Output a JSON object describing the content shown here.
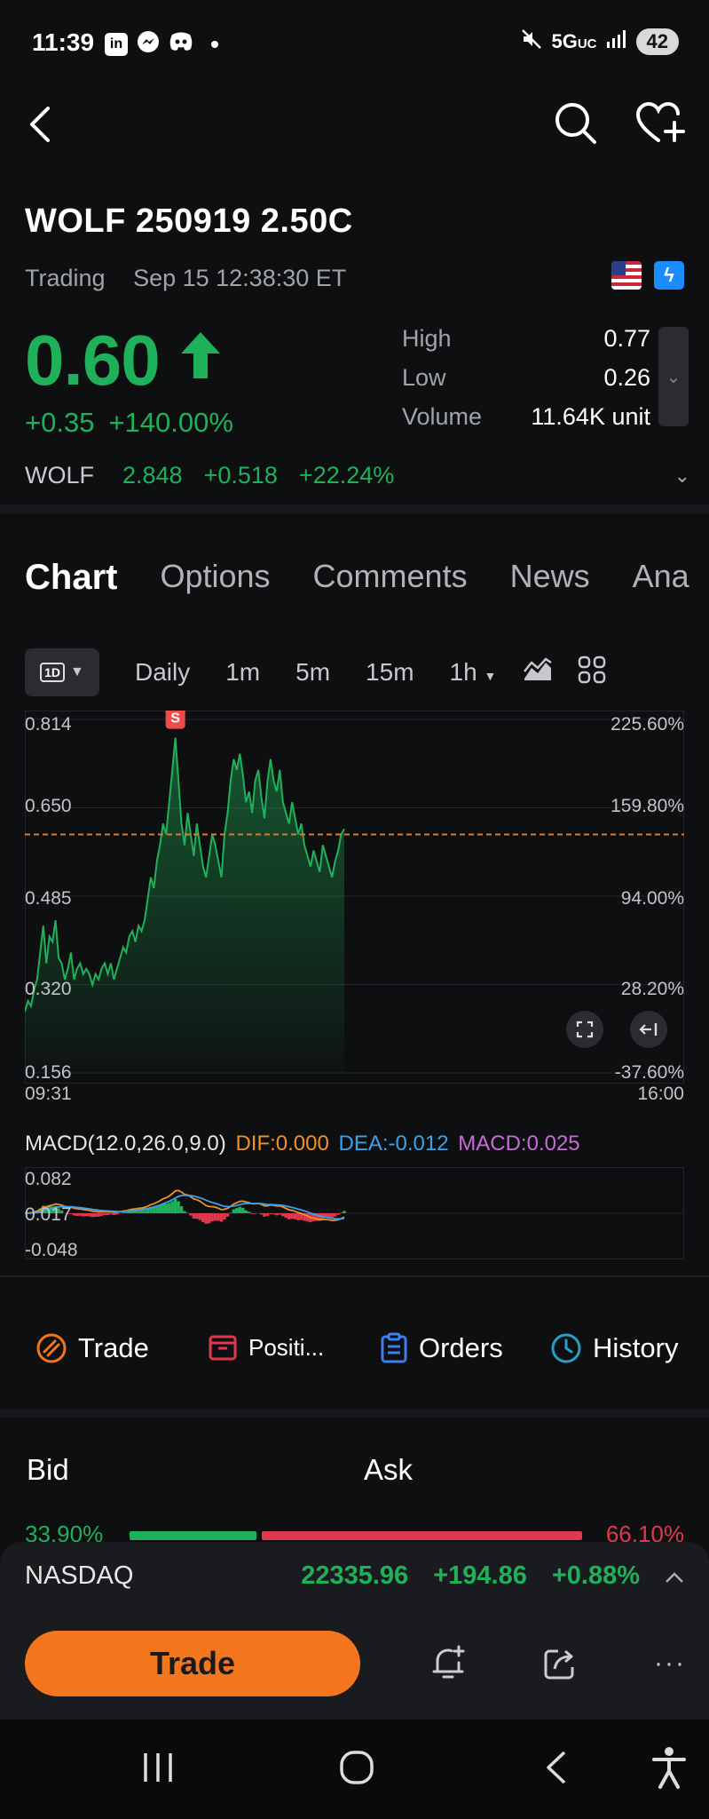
{
  "status_bar": {
    "time": "11:39",
    "app_icons": [
      "linkedin-icon",
      "messenger-icon",
      "discord-icon"
    ],
    "network": "5G",
    "network_suffix": "UC",
    "battery": "42"
  },
  "header": {
    "title": "WOLF 250919 2.50C",
    "state": "Trading",
    "timestamp": "Sep 15 12:38:30 ET",
    "price": "0.60",
    "change": "+0.35",
    "change_pct": "+140.00%",
    "stats": [
      {
        "label": "High",
        "value": "0.77"
      },
      {
        "label": "Low",
        "value": "0.26"
      },
      {
        "label": "Volume",
        "value": "11.64K unit"
      }
    ],
    "underlying": {
      "symbol": "WOLF",
      "price": "2.848",
      "change": "+0.518",
      "change_pct": "+22.24%"
    }
  },
  "tabs": [
    {
      "label": "Chart",
      "active": true,
      "dot": false
    },
    {
      "label": "Options",
      "active": false,
      "dot": false
    },
    {
      "label": "Comments",
      "active": false,
      "dot": true
    },
    {
      "label": "News",
      "active": false,
      "dot": true
    },
    {
      "label": "Ana",
      "active": false,
      "dot": false
    }
  ],
  "chart_toolbar": {
    "period_badge": "1D",
    "periods": [
      "Daily",
      "1m",
      "5m",
      "15m",
      "1h"
    ]
  },
  "chart_data": {
    "type": "area",
    "y_left_ticks": [
      "0.814",
      "0.650",
      "0.485",
      "0.320",
      "0.156"
    ],
    "y_right_ticks": [
      "225.60%",
      "159.80%",
      "94.00%",
      "28.20%",
      "-37.60%"
    ],
    "x_ticks": [
      "09:31",
      "16:00"
    ],
    "ylim": [
      0.156,
      0.814
    ],
    "reference_line": 0.6,
    "marker": "S",
    "values": [
      0.27,
      0.29,
      0.28,
      0.31,
      0.33,
      0.38,
      0.43,
      0.36,
      0.41,
      0.4,
      0.44,
      0.37,
      0.36,
      0.33,
      0.35,
      0.38,
      0.33,
      0.35,
      0.36,
      0.34,
      0.35,
      0.34,
      0.32,
      0.34,
      0.33,
      0.35,
      0.36,
      0.34,
      0.36,
      0.33,
      0.35,
      0.37,
      0.39,
      0.38,
      0.41,
      0.42,
      0.4,
      0.43,
      0.42,
      0.44,
      0.48,
      0.52,
      0.5,
      0.55,
      0.58,
      0.62,
      0.6,
      0.66,
      0.72,
      0.78,
      0.7,
      0.62,
      0.58,
      0.64,
      0.6,
      0.56,
      0.62,
      0.58,
      0.54,
      0.52,
      0.56,
      0.6,
      0.58,
      0.55,
      0.52,
      0.6,
      0.64,
      0.7,
      0.74,
      0.72,
      0.75,
      0.71,
      0.66,
      0.68,
      0.64,
      0.7,
      0.72,
      0.67,
      0.63,
      0.7,
      0.74,
      0.7,
      0.68,
      0.72,
      0.66,
      0.64,
      0.62,
      0.66,
      0.63,
      0.6,
      0.62,
      0.58,
      0.56,
      0.54,
      0.57,
      0.55,
      0.53,
      0.58,
      0.56,
      0.54,
      0.52,
      0.55,
      0.57,
      0.6,
      0.61
    ]
  },
  "macd": {
    "label": "MACD(12.0,26.0,9.0)",
    "dif": "DIF:0.000",
    "dea": "DEA:-0.012",
    "macd": "MACD:0.025",
    "ticks": [
      "0.082",
      "0.017",
      "-0.048"
    ],
    "colors": {
      "dif": "#f0902a",
      "dea": "#3aa0e8",
      "macd": "#c86ad8"
    }
  },
  "actions": [
    {
      "label": "Trade",
      "icon": "trade-icon"
    },
    {
      "label": "Positi...",
      "icon": "positions-icon"
    },
    {
      "label": "Orders",
      "icon": "orders-icon"
    },
    {
      "label": "History",
      "icon": "history-icon"
    }
  ],
  "bid_ask": {
    "bid_label": "Bid",
    "ask_label": "Ask",
    "bid_pct": "33.90%",
    "ask_pct": "66.10%",
    "bid_fraction": 0.339
  },
  "index": {
    "name": "NASDAQ",
    "value": "22335.96",
    "change": "+194.86",
    "change_pct": "+0.88%"
  },
  "bottom": {
    "trade_label": "Trade",
    "more": "···"
  },
  "colors": {
    "green": "#1fb15a",
    "red": "#e0384f",
    "accent": "#f4761c"
  }
}
